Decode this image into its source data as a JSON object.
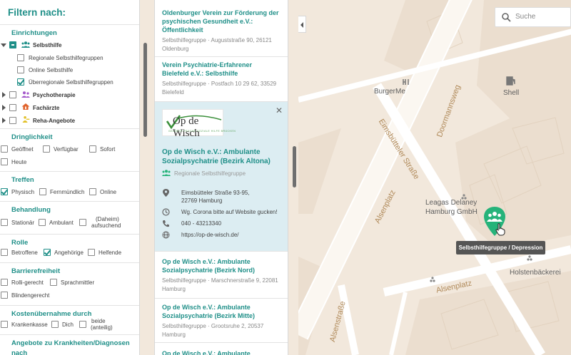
{
  "filter": {
    "title": "Filtern nach:",
    "einrichtungen": {
      "title": "Einrichtungen",
      "selbsthilfe": "Selbsthilfe",
      "sub": [
        "Regionale Selbsthilfegruppen",
        "Online Selbsthilfe",
        "Überregionale Selbsthilfegruppen"
      ],
      "categories": [
        "Psychotherapie",
        "Fachärzte",
        "Reha-Angebote"
      ]
    },
    "dringlichkeit": {
      "title": "Dringlichkeit",
      "options": [
        "Geöffnet",
        "Verfügbar",
        "Sofort",
        "Heute"
      ]
    },
    "treffen": {
      "title": "Treffen",
      "options": [
        "Physisch",
        "Fernmündlich",
        "Online"
      ]
    },
    "behandlung": {
      "title": "Behandlung",
      "options": [
        "Stationär",
        "Ambulant",
        "(Daheim)",
        "aufsuchend"
      ]
    },
    "rolle": {
      "title": "Rolle",
      "options": [
        "Betroffene",
        "Angehörige",
        "Helfende"
      ]
    },
    "barrierefreiheit": {
      "title": "Barrierefreiheit",
      "options": [
        "Rolli-gerecht",
        "Sprachmittler",
        "Blindengerecht"
      ]
    },
    "kosten": {
      "title": "Kostenübernahme durch",
      "options": [
        "Krankenkasse",
        "Dich",
        "beide",
        "(anteilig)"
      ]
    },
    "angebote": {
      "title": "Angebote zu Krankheiten/Diagnosen nach"
    }
  },
  "results": [
    {
      "title": "Oldenburger Verein zur Förderung der psychischen Gesundheit e.V.: Öffentlichkeit",
      "sub": "Selbsthilfegruppe · Auguststraße 90, 26121 Oldenburg"
    },
    {
      "title": "Verein Psychiatrie-Erfahrener Bielefeld e.V.: Selbsthilfe",
      "sub": "Selbsthilfegruppe · Postfach 10 29 62, 33529 Bielefeld"
    },
    {
      "title": "Op de Wisch e.V.: Ambulante Sozialpsychatrie (Bezirk Nord)",
      "sub": "Selbsthilfegruppe · Marschnerstraße 9, 22081 Hamburg"
    },
    {
      "title": "Op de Wisch e.V.: Ambulante Sozialpsychatrie (Bezirk Mitte)",
      "sub": "Selbsthilfegruppe · Grootsruhe 2, 20537 Hamburg"
    },
    {
      "title": "Op de Wisch e.V.: Ambulante"
    }
  ],
  "detail": {
    "logo_text": "Op de Wisch",
    "logo_sub": "GELEBTE PSYCHE SOZIALE HILFE BRÜCKEN",
    "title": "Op de Wisch e.V.: Ambulante Sozialpsychatrie (Bezirk Altona)",
    "category": "Regionale Selbsthilfegruppe",
    "address1": "Eimsbütteler Straße 93-95,",
    "address2": "22769 Hamburg",
    "note": "Wg. Corona bitte auf Website gucken!",
    "phone": "040 - 43213340",
    "website": "https://op-de-wisch.de/"
  },
  "map": {
    "search_placeholder": "Suche",
    "places": {
      "burgerme": "BurgerMe",
      "shell": "Shell",
      "leagas1": "Leagas Delaney",
      "leagas2": "Hamburg GmbH",
      "holsten": "Holstenbäckerei"
    },
    "streets": {
      "doormannsweg": "Doormannsweg",
      "eimsbuetteler": "Eimsbütteler Straße",
      "alsenplatz1": "Alsenplatz",
      "alsenplatz2": "Alsenplatz",
      "alsenstrasse": "Alsenstraße"
    },
    "tooltip": "Selbsthilfegruppe / Depression"
  },
  "colors": {
    "accent": "#1f8f88",
    "marker": "#26b37a",
    "detail_bg": "#dcedf2"
  }
}
